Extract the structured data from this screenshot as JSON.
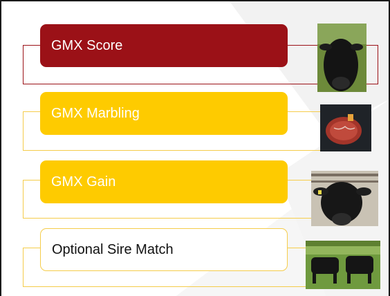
{
  "colors": {
    "dark_red": "#9b1117",
    "gold": "#fecb00",
    "bracket_gold": "#f5cc4a",
    "white": "#ffffff",
    "text_dark": "#111111"
  },
  "items": [
    {
      "label": "GMX Score",
      "style": "dark-red",
      "photo_icon": "cow-head-photo"
    },
    {
      "label": "GMX Marbling",
      "style": "gold",
      "photo_icon": "steak-photo"
    },
    {
      "label": "GMX Gain",
      "style": "gold",
      "photo_icon": "cow-feedlot-photo"
    },
    {
      "label": "Optional Sire Match",
      "style": "outline",
      "photo_icon": "cattle-pasture-photo"
    }
  ]
}
